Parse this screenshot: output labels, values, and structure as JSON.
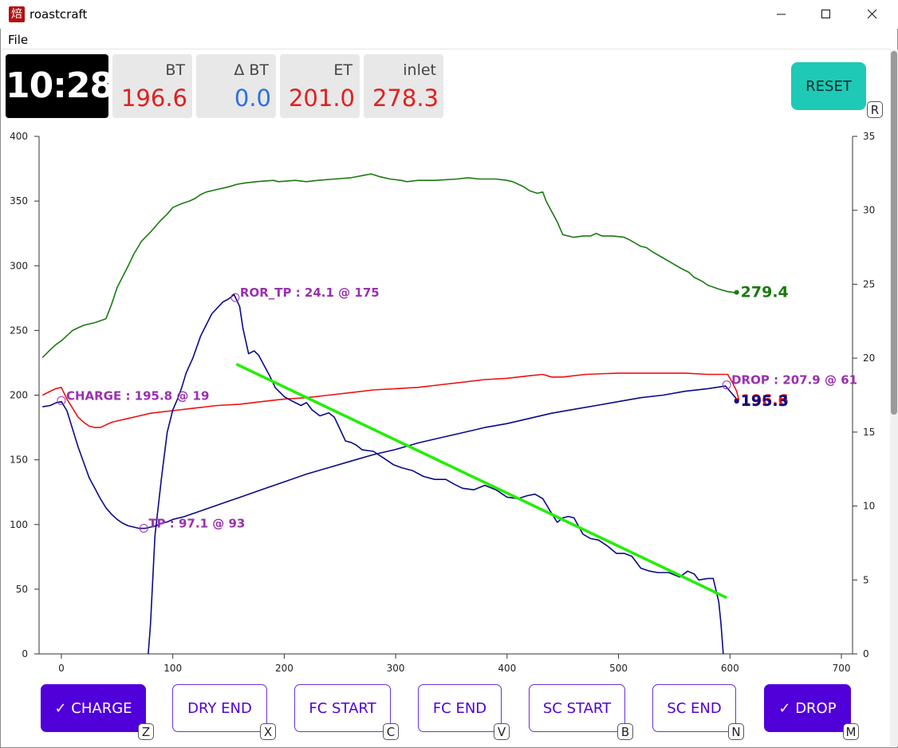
{
  "window": {
    "app_icon_glyph": "焙",
    "title": "roastcraft",
    "controls": [
      "minimize-icon",
      "maximize-icon",
      "close-icon"
    ]
  },
  "menu": {
    "file": "File"
  },
  "readouts": {
    "timer": "10:28",
    "bt": {
      "label": "BT",
      "value": "196.6",
      "color": "#e02020"
    },
    "delta_bt": {
      "label": "Δ BT",
      "value": "0.0",
      "color": "#2e6fe0"
    },
    "et": {
      "label": "ET",
      "value": "201.0",
      "color": "#e02020"
    },
    "inlet": {
      "label": "inlet",
      "value": "278.3",
      "color": "#e02020"
    }
  },
  "reset": {
    "label": "RESET",
    "key": "R"
  },
  "events": [
    {
      "label": "✓ CHARGE",
      "key": "Z",
      "active": true
    },
    {
      "label": "DRY END",
      "key": "X",
      "active": false
    },
    {
      "label": "FC START",
      "key": "C",
      "active": false
    },
    {
      "label": "FC END",
      "key": "V",
      "active": false
    },
    {
      "label": "SC START",
      "key": "B",
      "active": false
    },
    {
      "label": "SC END",
      "key": "N",
      "active": false
    },
    {
      "label": "✓ DROP",
      "key": "M",
      "active": true
    }
  ],
  "chart_data": {
    "type": "line",
    "title": "",
    "xlim": [
      -20,
      710
    ],
    "x_ticks": [
      0,
      100,
      200,
      300,
      400,
      500,
      600,
      700
    ],
    "ylim": [
      0,
      400
    ],
    "y_ticks": [
      0,
      50,
      100,
      150,
      200,
      250,
      300,
      350,
      400
    ],
    "y2lim": [
      0,
      35
    ],
    "y2_ticks": [
      0,
      5,
      10,
      15,
      20,
      25,
      30,
      35
    ],
    "grid": false,
    "colors": {
      "inlet": "#1a7a10",
      "et": "#ee1111",
      "bt": "#0a0a8a",
      "ror": "#0a0a8a",
      "trend": "#22ee00",
      "event": "#9a30b0"
    },
    "series": [
      {
        "key": "inlet",
        "axis": "left",
        "points": [
          [
            -17,
            229
          ],
          [
            -10,
            235
          ],
          [
            -5,
            239
          ],
          [
            0,
            242
          ],
          [
            5,
            246
          ],
          [
            10,
            250
          ],
          [
            15,
            252
          ],
          [
            20,
            254
          ],
          [
            30,
            256
          ],
          [
            40,
            259
          ],
          [
            45,
            270
          ],
          [
            50,
            283
          ],
          [
            60,
            300
          ],
          [
            65,
            309
          ],
          [
            72,
            319
          ],
          [
            80,
            326
          ],
          [
            88,
            334
          ],
          [
            95,
            340
          ],
          [
            100,
            345
          ],
          [
            108,
            348
          ],
          [
            115,
            350
          ],
          [
            120,
            352
          ],
          [
            125,
            355
          ],
          [
            130,
            357
          ],
          [
            135,
            358
          ],
          [
            140,
            359
          ],
          [
            150,
            361
          ],
          [
            158,
            363
          ],
          [
            165,
            364
          ],
          [
            175,
            365
          ],
          [
            190,
            366
          ],
          [
            195,
            365
          ],
          [
            210,
            366
          ],
          [
            220,
            365
          ],
          [
            230,
            366
          ],
          [
            245,
            367
          ],
          [
            260,
            368
          ],
          [
            272,
            370
          ],
          [
            278,
            371
          ],
          [
            285,
            369
          ],
          [
            295,
            367
          ],
          [
            305,
            366
          ],
          [
            310,
            365
          ],
          [
            320,
            366
          ],
          [
            335,
            366
          ],
          [
            355,
            367
          ],
          [
            365,
            368
          ],
          [
            375,
            367
          ],
          [
            390,
            367
          ],
          [
            400,
            366
          ],
          [
            405,
            365
          ],
          [
            410,
            363
          ],
          [
            415,
            361
          ],
          [
            420,
            358
          ],
          [
            427,
            356
          ],
          [
            432,
            357
          ],
          [
            435,
            350
          ],
          [
            440,
            342
          ],
          [
            445,
            334
          ],
          [
            450,
            324
          ],
          [
            460,
            322
          ],
          [
            468,
            323
          ],
          [
            475,
            323
          ],
          [
            480,
            325
          ],
          [
            485,
            323
          ],
          [
            495,
            323
          ],
          [
            505,
            322
          ],
          [
            510,
            320
          ],
          [
            520,
            315
          ],
          [
            525,
            314
          ],
          [
            530,
            311
          ],
          [
            540,
            306
          ],
          [
            550,
            301
          ],
          [
            556,
            298
          ],
          [
            563,
            295
          ],
          [
            568,
            291
          ],
          [
            575,
            288
          ],
          [
            580,
            285
          ],
          [
            590,
            282
          ],
          [
            598,
            280
          ],
          [
            606,
            279
          ]
        ]
      },
      {
        "key": "et",
        "axis": "left",
        "points": [
          [
            -17,
            200
          ],
          [
            -10,
            203
          ],
          [
            -5,
            205
          ],
          [
            0,
            206
          ],
          [
            5,
            197
          ],
          [
            10,
            190
          ],
          [
            15,
            183
          ],
          [
            20,
            179
          ],
          [
            25,
            176
          ],
          [
            30,
            175
          ],
          [
            35,
            175
          ],
          [
            40,
            177
          ],
          [
            45,
            179
          ],
          [
            50,
            180
          ],
          [
            60,
            182
          ],
          [
            70,
            184
          ],
          [
            80,
            186
          ],
          [
            90,
            187
          ],
          [
            100,
            188
          ],
          [
            120,
            190
          ],
          [
            140,
            192
          ],
          [
            160,
            193
          ],
          [
            180,
            195
          ],
          [
            200,
            197
          ],
          [
            220,
            198
          ],
          [
            240,
            200
          ],
          [
            260,
            202
          ],
          [
            280,
            204
          ],
          [
            300,
            205
          ],
          [
            320,
            206
          ],
          [
            340,
            208
          ],
          [
            360,
            210
          ],
          [
            380,
            212
          ],
          [
            400,
            213
          ],
          [
            420,
            215
          ],
          [
            432,
            216
          ],
          [
            440,
            214
          ],
          [
            450,
            214
          ],
          [
            470,
            216
          ],
          [
            500,
            217
          ],
          [
            530,
            217
          ],
          [
            560,
            217
          ],
          [
            580,
            216
          ],
          [
            598,
            216
          ],
          [
            602,
            210
          ],
          [
            606,
            203
          ],
          [
            608,
            196
          ]
        ]
      },
      {
        "key": "bt",
        "axis": "left",
        "points": [
          [
            -17,
            191
          ],
          [
            -10,
            192
          ],
          [
            -5,
            194
          ],
          [
            0,
            195
          ],
          [
            5,
            188
          ],
          [
            10,
            174
          ],
          [
            15,
            160
          ],
          [
            20,
            148
          ],
          [
            25,
            136
          ],
          [
            30,
            128
          ],
          [
            35,
            120
          ],
          [
            40,
            113
          ],
          [
            45,
            108
          ],
          [
            50,
            104
          ],
          [
            55,
            101
          ],
          [
            60,
            99
          ],
          [
            65,
            98
          ],
          [
            70,
            97
          ],
          [
            75,
            97
          ],
          [
            80,
            98
          ],
          [
            85,
            99
          ],
          [
            90,
            101
          ],
          [
            95,
            102
          ],
          [
            100,
            104
          ],
          [
            110,
            106
          ],
          [
            120,
            109
          ],
          [
            130,
            112
          ],
          [
            140,
            115
          ],
          [
            150,
            118
          ],
          [
            160,
            121
          ],
          [
            180,
            127
          ],
          [
            200,
            133
          ],
          [
            220,
            139
          ],
          [
            240,
            144
          ],
          [
            260,
            149
          ],
          [
            280,
            154
          ],
          [
            300,
            158
          ],
          [
            320,
            163
          ],
          [
            340,
            167
          ],
          [
            360,
            171
          ],
          [
            380,
            175
          ],
          [
            400,
            178
          ],
          [
            420,
            182
          ],
          [
            440,
            186
          ],
          [
            460,
            189
          ],
          [
            480,
            192
          ],
          [
            500,
            195
          ],
          [
            520,
            198
          ],
          [
            540,
            200
          ],
          [
            560,
            203
          ],
          [
            580,
            205
          ],
          [
            596,
            207
          ],
          [
            600,
            203
          ],
          [
            605,
            198
          ],
          [
            606,
            196
          ]
        ]
      },
      {
        "key": "ror",
        "axis": "right",
        "points": [
          [
            78,
            0
          ],
          [
            80,
            2
          ],
          [
            82,
            5
          ],
          [
            84,
            8
          ],
          [
            87,
            10
          ],
          [
            90,
            12
          ],
          [
            95,
            15
          ],
          [
            100,
            16.5
          ],
          [
            104,
            17.2
          ],
          [
            108,
            18
          ],
          [
            112,
            19
          ],
          [
            118,
            20
          ],
          [
            125,
            21.5
          ],
          [
            135,
            23
          ],
          [
            145,
            23.8
          ],
          [
            150,
            24
          ],
          [
            155,
            24.3
          ],
          [
            160,
            23.5
          ],
          [
            163,
            22
          ],
          [
            168,
            20.3
          ],
          [
            173,
            20.5
          ],
          [
            177,
            20.2
          ],
          [
            182,
            19.5
          ],
          [
            187,
            18.8
          ],
          [
            192,
            18
          ],
          [
            200,
            17.4
          ],
          [
            207,
            17.1
          ],
          [
            215,
            16.8
          ],
          [
            220,
            17
          ],
          [
            225,
            16.5
          ],
          [
            232,
            16.1
          ],
          [
            240,
            16.3
          ],
          [
            245,
            16
          ],
          [
            250,
            15.2
          ],
          [
            255,
            14.4
          ],
          [
            260,
            14.3
          ],
          [
            265,
            14.1
          ],
          [
            270,
            13.8
          ],
          [
            280,
            13.7
          ],
          [
            290,
            13.2
          ],
          [
            298,
            12.8
          ],
          [
            305,
            12.6
          ],
          [
            315,
            12.4
          ],
          [
            325,
            12
          ],
          [
            335,
            11.8
          ],
          [
            345,
            11.8
          ],
          [
            352,
            11.5
          ],
          [
            360,
            11.2
          ],
          [
            370,
            11.1
          ],
          [
            380,
            11.4
          ],
          [
            390,
            11.1
          ],
          [
            400,
            10.6
          ],
          [
            410,
            10.5
          ],
          [
            418,
            10.7
          ],
          [
            425,
            10.8
          ],
          [
            432,
            10.5
          ],
          [
            440,
            9.5
          ],
          [
            445,
            8.9
          ],
          [
            450,
            9.2
          ],
          [
            455,
            9.3
          ],
          [
            460,
            9.2
          ],
          [
            468,
            8.1
          ],
          [
            475,
            7.8
          ],
          [
            482,
            7.7
          ],
          [
            490,
            7.3
          ],
          [
            498,
            6.8
          ],
          [
            505,
            6.8
          ],
          [
            512,
            6.6
          ],
          [
            520,
            5.8
          ],
          [
            528,
            5.6
          ],
          [
            535,
            5.5
          ],
          [
            545,
            5.5
          ],
          [
            555,
            5.2
          ],
          [
            562,
            5.6
          ],
          [
            568,
            5.4
          ],
          [
            572,
            5
          ],
          [
            580,
            5.1
          ],
          [
            585,
            5.1
          ],
          [
            590,
            3.5
          ],
          [
            592,
            2
          ],
          [
            594,
            0
          ]
        ]
      }
    ],
    "trend_line": {
      "axis": "right",
      "points": [
        [
          157,
          19.6
        ],
        [
          597,
          3.8
        ]
      ]
    },
    "events": [
      {
        "label": "CHARGE : 195.8 @ 19",
        "x": 0,
        "y": 195.8,
        "axis": "left"
      },
      {
        "label": "TP : 97.1 @ 93",
        "x": 74,
        "y": 97.1,
        "axis": "left"
      },
      {
        "label": "ROR_TP : 24.1 @ 175",
        "x": 156,
        "y": 24.1,
        "axis": "right"
      },
      {
        "label": "DROP : 207.9 @ 61",
        "x": 597,
        "y": 207.9,
        "axis": "left"
      }
    ],
    "end_labels": [
      {
        "series": "inlet",
        "text": "279.4",
        "x": 606,
        "y": 279.4
      },
      {
        "series": "et",
        "text": "196.6",
        "x": 606,
        "y": 196
      },
      {
        "series": "bt",
        "text": "195.3",
        "x": 606,
        "y": 195.3
      }
    ]
  }
}
